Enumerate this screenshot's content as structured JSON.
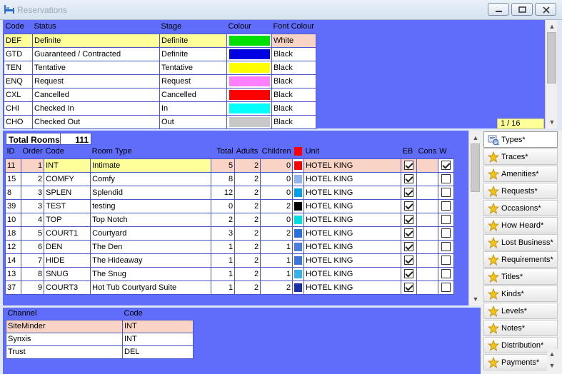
{
  "window": {
    "title": "Reservations"
  },
  "status_grid": {
    "headers": [
      "Code",
      "Status",
      "Stage",
      "Colour",
      "Font Colour"
    ],
    "rows": [
      {
        "code": "DEF",
        "status": "Definite",
        "stage": "Definite",
        "colour": "#00e000",
        "font": "White"
      },
      {
        "code": "GTD",
        "status": "Guaranteed / Contracted",
        "stage": "Definite",
        "colour": "#0000e0",
        "font": "Black"
      },
      {
        "code": "TEN",
        "status": "Tentative",
        "stage": "Tentative",
        "colour": "#ffff00",
        "font": "Black"
      },
      {
        "code": "ENQ",
        "status": "Request",
        "stage": "Request",
        "colour": "#ff80ff",
        "font": "Black"
      },
      {
        "code": "CXL",
        "status": "Cancelled",
        "stage": "Cancelled",
        "colour": "#ff0000",
        "font": "Black"
      },
      {
        "code": "CHI",
        "status": "Checked In",
        "stage": "In",
        "colour": "#00ffff",
        "font": "Black"
      },
      {
        "code": "CHO",
        "status": "Checked Out",
        "stage": "Out",
        "colour": "#c8c8c8",
        "font": "Black"
      }
    ],
    "pager": "1 / 16"
  },
  "room_grid": {
    "total_label": "Total Rooms",
    "total_value": "111",
    "headers": [
      "ID",
      "Order",
      "Code",
      "Room Type",
      "Total",
      "Adults",
      "Children",
      "",
      "Unit",
      "EB",
      "Cons",
      "W"
    ],
    "header_swatch": "#ff0000",
    "rows": [
      {
        "id": "11",
        "order": "1",
        "code": "INT",
        "type": "Intimate",
        "total": "5",
        "adults": "2",
        "children": "0",
        "swatch": "#ff0000",
        "unit": "HOTEL KING",
        "eb": true,
        "w": true
      },
      {
        "id": "15",
        "order": "2",
        "code": "COMFY",
        "type": "Comfy",
        "total": "8",
        "adults": "2",
        "children": "0",
        "swatch": "#8fb4ee",
        "unit": "HOTEL KING",
        "eb": true,
        "w": false
      },
      {
        "id": "8",
        "order": "3",
        "code": "SPLEN",
        "type": "Splendid",
        "total": "12",
        "adults": "2",
        "children": "0",
        "swatch": "#00a0e8",
        "unit": "HOTEL KING",
        "eb": true,
        "w": false
      },
      {
        "id": "39",
        "order": "3",
        "code": "TEST",
        "type": "testing",
        "total": "0",
        "adults": "2",
        "children": "2",
        "swatch": "#000000",
        "unit": "HOTEL KING",
        "eb": true,
        "w": false
      },
      {
        "id": "10",
        "order": "4",
        "code": "TOP",
        "type": "Top Notch",
        "total": "2",
        "adults": "2",
        "children": "0",
        "swatch": "#00e0e0",
        "unit": "HOTEL KING",
        "eb": true,
        "w": false
      },
      {
        "id": "18",
        "order": "5",
        "code": "COURT1",
        "type": "Courtyard",
        "total": "3",
        "adults": "2",
        "children": "2",
        "swatch": "#2a6fe0",
        "unit": "HOTEL KING",
        "eb": true,
        "w": false
      },
      {
        "id": "12",
        "order": "6",
        "code": "DEN",
        "type": "The Den",
        "total": "1",
        "adults": "2",
        "children": "1",
        "swatch": "#4a7fe0",
        "unit": "HOTEL KING",
        "eb": true,
        "w": false
      },
      {
        "id": "14",
        "order": "7",
        "code": "HIDE",
        "type": "The Hideaway",
        "total": "1",
        "adults": "2",
        "children": "1",
        "swatch": "#3d74d8",
        "unit": "HOTEL KING",
        "eb": true,
        "w": false
      },
      {
        "id": "13",
        "order": "8",
        "code": "SNUG",
        "type": "The Snug",
        "total": "1",
        "adults": "2",
        "children": "1",
        "swatch": "#3ab0e8",
        "unit": "HOTEL KING",
        "eb": true,
        "w": false
      },
      {
        "id": "37",
        "order": "9",
        "code": "COURT3",
        "type": "Hot Tub Courtyard Suite",
        "total": "1",
        "adults": "2",
        "children": "2",
        "swatch": "#1a2fa8",
        "unit": "HOTEL KING",
        "eb": true,
        "w": false
      }
    ]
  },
  "channel_grid": {
    "headers": [
      "Channel",
      "Code"
    ],
    "rows": [
      {
        "channel": "SiteMinder",
        "code": "INT"
      },
      {
        "channel": "Synxis",
        "code": "INT"
      },
      {
        "channel": "Trust",
        "code": "DEL"
      }
    ]
  },
  "sidebar": {
    "items": [
      {
        "label": "Types*",
        "icon": "types-icon"
      },
      {
        "label": "Traces*",
        "icon": "star-icon"
      },
      {
        "label": "Amenities*",
        "icon": "star-icon"
      },
      {
        "label": "Requests*",
        "icon": "star-icon"
      },
      {
        "label": "Occasions*",
        "icon": "star-icon"
      },
      {
        "label": "How Heard*",
        "icon": "star-icon"
      },
      {
        "label": "Lost Business*",
        "icon": "star-icon"
      },
      {
        "label": "Requirements*",
        "icon": "star-icon"
      },
      {
        "label": "Titles*",
        "icon": "star-icon"
      },
      {
        "label": "Kinds*",
        "icon": "star-icon"
      },
      {
        "label": "Levels*",
        "icon": "star-icon"
      },
      {
        "label": "Notes*",
        "icon": "star-icon"
      },
      {
        "label": "Distribution*",
        "icon": "star-icon"
      },
      {
        "label": "Payments*",
        "icon": "star-icon"
      }
    ]
  }
}
